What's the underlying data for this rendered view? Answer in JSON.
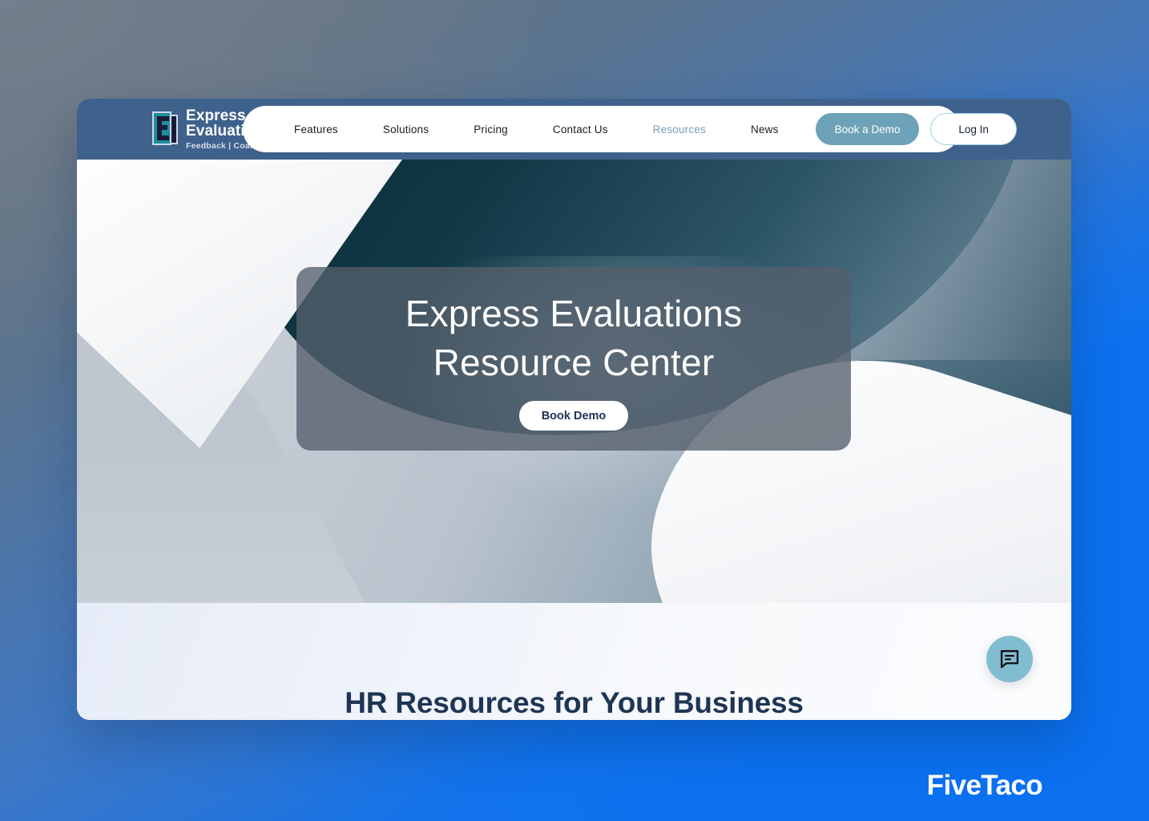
{
  "brand": {
    "name_line1": "Express",
    "name_line2": "Evaluations",
    "tagline": "Feedback | Coaching | Growth",
    "logo_icon": "express-evaluations-e-logo"
  },
  "nav": {
    "links": [
      {
        "label": "Features",
        "active": false
      },
      {
        "label": "Solutions",
        "active": false
      },
      {
        "label": "Pricing",
        "active": false
      },
      {
        "label": "Contact Us",
        "active": false
      },
      {
        "label": "Resources",
        "active": true
      },
      {
        "label": "News",
        "active": false
      }
    ],
    "book_demo_label": "Book a Demo",
    "login_label": "Log In"
  },
  "hero": {
    "title_line1": "Express Evaluations",
    "title_line2": "Resource Center",
    "cta_label": "Book Demo"
  },
  "content": {
    "section_heading": "HR Resources for Your Business"
  },
  "chat": {
    "icon": "chat-bubble-icon"
  },
  "watermark": {
    "text": "FiveTaco"
  },
  "colors": {
    "header_bar": "#3f628d",
    "brand_teal": "#1d8e9e",
    "brand_navy": "#1b1b38",
    "demo_button": "#6ea2b8",
    "login_border": "#9ed0df",
    "nav_active_text": "#7e9cb4",
    "hero_card_overlay": "#545f6b",
    "heading_navy": "#1e3554",
    "chat_fab": "#81bdd0",
    "page_blue": "#0d71f0"
  }
}
